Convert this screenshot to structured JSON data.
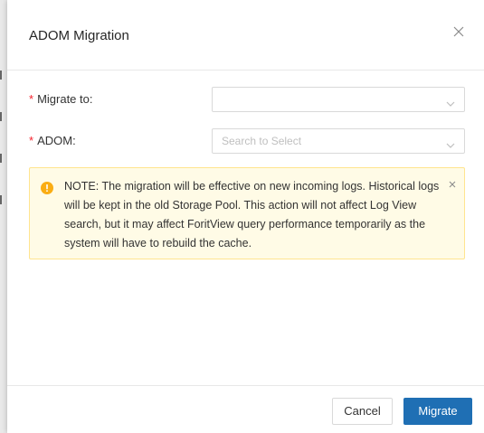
{
  "modal": {
    "title": "ADOM Migration"
  },
  "form": {
    "required_mark": "*",
    "migrate_to": {
      "label": "Migrate to:",
      "value": ""
    },
    "adom": {
      "label": "ADOM:",
      "placeholder": "Search to Select"
    }
  },
  "note": {
    "text": "NOTE: The migration will be effective on new incoming logs. Historical logs will be kept in the old Storage Pool. This action will not affect Log View search, but it may affect ForitView query performance temporarily as the system will have to rebuild the cache."
  },
  "footer": {
    "cancel_label": "Cancel",
    "primary_label": "Migrate"
  },
  "colors": {
    "primary": "#1f6fb4",
    "required": "#f5222d",
    "warning_icon": "#faad14",
    "warning_bg": "#fffbe6",
    "warning_border": "#ffe58f"
  }
}
